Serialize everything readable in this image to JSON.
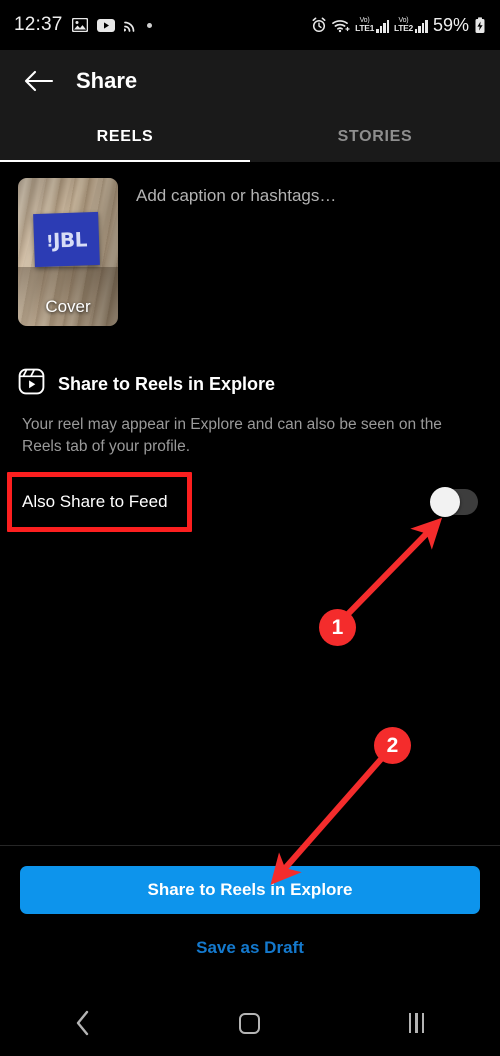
{
  "status_bar": {
    "time": "12:37",
    "left_icons": [
      "gallery-icon",
      "youtube-icon",
      "cast-icon",
      "dot-icon"
    ],
    "alarm_icon": "alarm-icon",
    "wifi_icon": "wifi-icon",
    "sim1_volte": "Vo)",
    "sim1_network": "LTE1",
    "sim2_volte": "Vo)",
    "sim2_network": "LTE2",
    "battery_percent": "59%",
    "battery_icon": "battery-charging-icon"
  },
  "header": {
    "back_icon": "back-arrow-icon",
    "title": "Share",
    "tabs": [
      {
        "label": "REELS",
        "active": true
      },
      {
        "label": "STORIES",
        "active": false
      }
    ]
  },
  "composer": {
    "cover_label": "Cover",
    "cover_brand": "JBL",
    "caption_placeholder": "Add caption or hashtags…"
  },
  "explore_section": {
    "icon": "reels-icon",
    "title": "Share to Reels in Explore",
    "description": "Your reel may appear in Explore and can also be seen on the Reels tab of your profile."
  },
  "also_share_to_feed": {
    "label": "Also Share to Feed",
    "toggle_state": "off"
  },
  "actions": {
    "primary_label": "Share to Reels in Explore",
    "draft_label": "Save as Draft"
  },
  "nav_bar": {
    "back": "nav-back-icon",
    "home": "nav-home-icon",
    "recents": "nav-recents-icon"
  },
  "annotations": {
    "highlight_label": "Also Share to Feed",
    "markers": [
      {
        "number": "1",
        "target": "also-share-to-feed-toggle"
      },
      {
        "number": "2",
        "target": "share-to-reels-in-explore-button"
      }
    ]
  },
  "colors": {
    "accent_blue": "#0d94ec",
    "link_blue": "#1479cd",
    "annotation_red": "#f42c2c",
    "header_bg": "#1a1a1a",
    "page_bg": "#000000"
  }
}
